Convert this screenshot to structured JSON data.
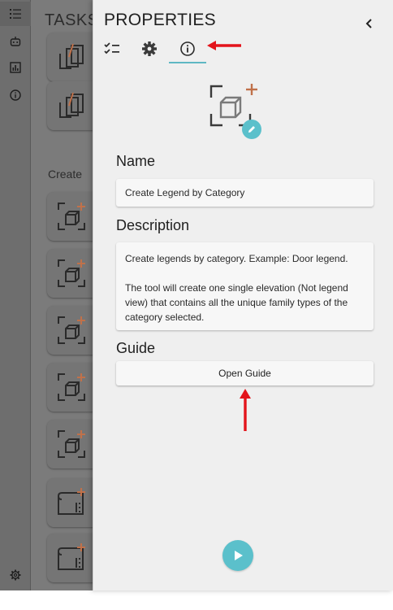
{
  "rail": {
    "icons": [
      "task-list-icon",
      "robot-icon",
      "chart-icon",
      "info-icon",
      "settings-icon"
    ]
  },
  "background_panel": {
    "title": "TASKS",
    "section_label": "Create"
  },
  "properties": {
    "title": "PROPERTIES",
    "tabs": [
      {
        "icon": "checklist-icon",
        "active": false
      },
      {
        "icon": "gear-icon",
        "active": false
      },
      {
        "icon": "info-icon",
        "active": true
      }
    ],
    "name_label": "Name",
    "name_value": "Create Legend by Category",
    "description_label": "Description",
    "description_line1": "Create legends by category. Example: Door legend.",
    "description_line2": "The tool will create one single elevation (Not legend view) that contains all the unique family types of the category selected.",
    "guide_label": "Guide",
    "guide_button": "Open Guide"
  },
  "colors": {
    "accent": "#5bc0cb",
    "annotation_arrow": "#e3141b",
    "panel_bg": "#efefef",
    "overlay_gray": "#7b7b7b",
    "icon_orange": "#c0714a"
  }
}
